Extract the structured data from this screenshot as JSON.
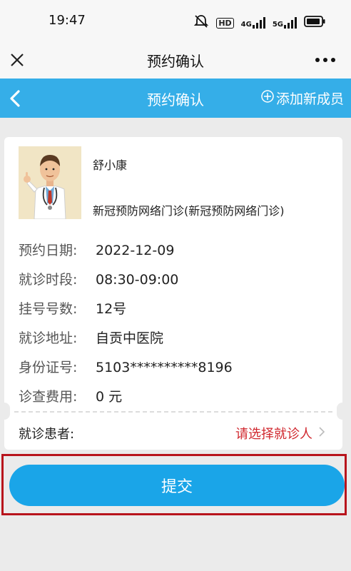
{
  "status_bar": {
    "time": "19:47",
    "icons": [
      "mute-bell-icon",
      "hd-icon",
      "signal-4g-icon",
      "signal-5g-icon",
      "battery-icon"
    ],
    "hd_label": "HD",
    "net_4g": "4G",
    "net_5g": "5G"
  },
  "app_bar": {
    "title": "预约确认",
    "close_icon": "close-icon",
    "more_icon": "more-icon"
  },
  "header": {
    "title": "预约确认",
    "back_icon": "chevron-left-icon",
    "add_member_label": "添加新成员",
    "accent_color": "#35aee8"
  },
  "doctor": {
    "name": "舒小康",
    "department": "新冠预防网络门诊(新冠预防网络门诊)"
  },
  "details": [
    {
      "label": "预约日期:",
      "value": "2022-12-09"
    },
    {
      "label": "就诊时段:",
      "value": "08:30-09:00"
    },
    {
      "label": "挂号号数:",
      "value": "12号"
    },
    {
      "label": "就诊地址:",
      "value": "自贡中医院"
    },
    {
      "label": "身份证号:",
      "value": "5103**********8196"
    },
    {
      "label": "诊查费用:",
      "value": "0 元"
    }
  ],
  "patient": {
    "label": "就诊患者:",
    "select_label": "请选择就诊人",
    "select_color": "#d0272e"
  },
  "submit": {
    "label": "提交",
    "color": "#1aa5e8"
  }
}
